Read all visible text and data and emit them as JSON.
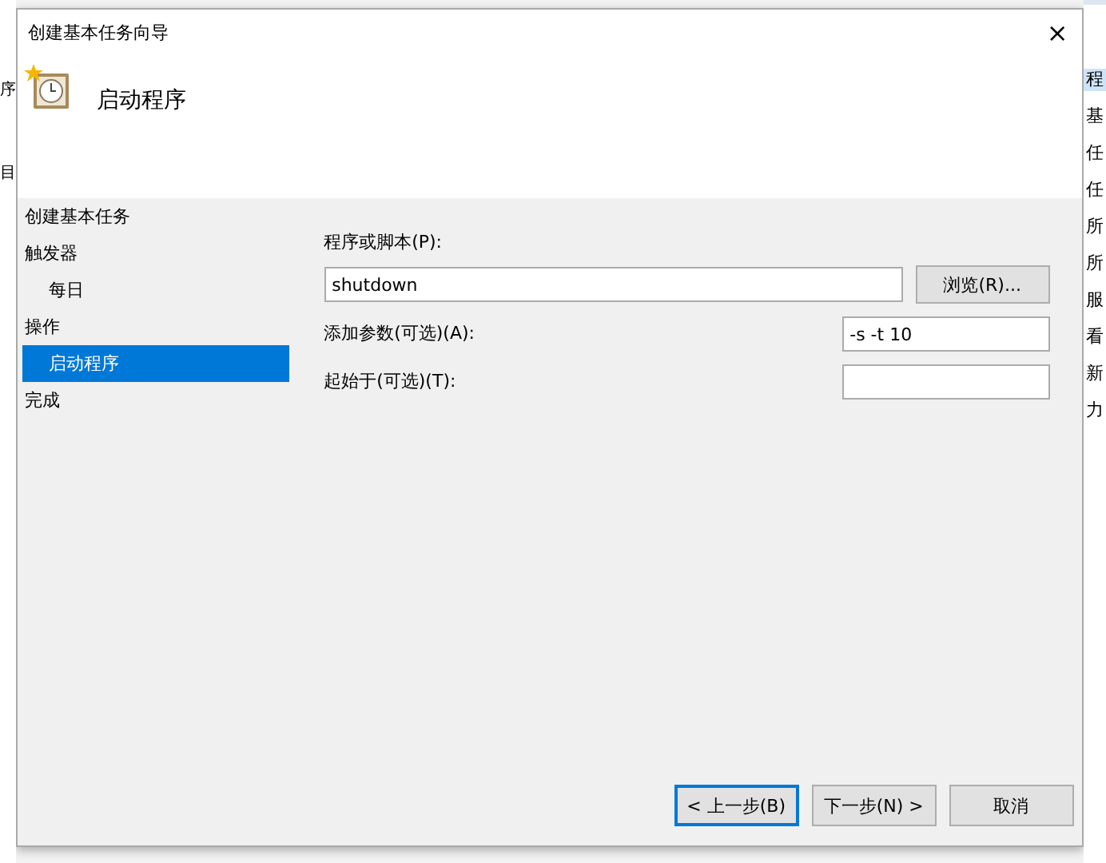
{
  "background_window": {
    "left_fragments": [
      "序",
      "目"
    ],
    "right_fragments": [
      {
        "text": "程",
        "selected": true
      },
      {
        "text": "基",
        "selected": false
      },
      {
        "text": "任",
        "selected": false
      },
      {
        "text": "任",
        "selected": false
      },
      {
        "text": "所",
        "selected": false
      },
      {
        "text": "所",
        "selected": false
      },
      {
        "text": "服",
        "selected": false
      },
      {
        "text": "看",
        "selected": false
      },
      {
        "text": "新",
        "selected": false
      },
      {
        "text": "力",
        "selected": false
      }
    ]
  },
  "window": {
    "title": "创建基本任务向导",
    "close": "×"
  },
  "header": {
    "title": "启动程序"
  },
  "steps": [
    {
      "label": "创建基本任务",
      "selected": false
    },
    {
      "label": "触发器",
      "selected": false,
      "children": [
        {
          "label": "每日",
          "selected": false
        }
      ]
    },
    {
      "label": "操作",
      "selected": false,
      "children": [
        {
          "label": "启动程序",
          "selected": true
        }
      ]
    },
    {
      "label": "完成",
      "selected": false
    }
  ],
  "form": {
    "program_label": "程序或脚本(P):",
    "program_value": "shutdown",
    "browse_button": "浏览(R)...",
    "args_label": "添加参数(可选)(A):",
    "args_value": "-s -t 10",
    "start_label": "起始于(可选)(T):"
  },
  "buttons": [
    {
      "label": "< 上一步(B)",
      "focused": true
    },
    {
      "label": "下一步(N) >",
      "focused": false
    },
    {
      "label": "取消",
      "focused": false
    }
  ]
}
